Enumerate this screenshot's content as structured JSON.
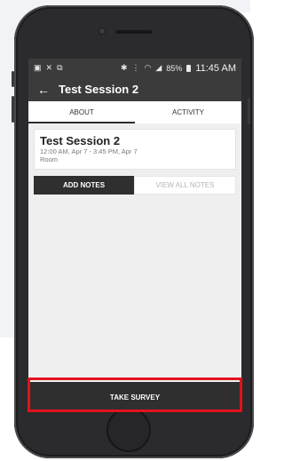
{
  "status_bar": {
    "time": "11:45 AM",
    "battery": "85%",
    "left_icons": [
      "notification-icon",
      "missed-call-icon",
      "screenshot-icon"
    ],
    "right_icons": [
      "bluetooth-icon",
      "vibrate-icon",
      "wifi-icon",
      "signal-icon"
    ]
  },
  "app_bar": {
    "title": "Test Session 2",
    "back_glyph": "←"
  },
  "tabs": [
    {
      "label": "ABOUT",
      "active": true
    },
    {
      "label": "ACTIVITY",
      "active": false
    }
  ],
  "session": {
    "title": "Test Session 2",
    "time": "12:00 AM, Apr 7 - 3:45 PM, Apr 7",
    "location": "Room"
  },
  "notes": {
    "add_label": "ADD NOTES",
    "view_label": "VIEW ALL NOTES"
  },
  "survey": {
    "label": "TAKE SURVEY",
    "highlight_color": "#e3121b"
  }
}
